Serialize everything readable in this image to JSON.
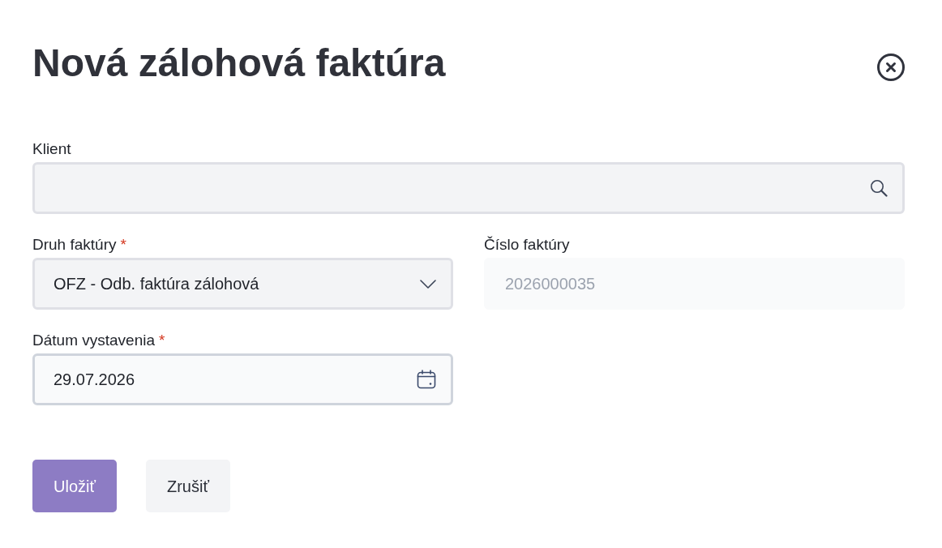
{
  "dialog": {
    "title": "Nová zálohová faktúra"
  },
  "form": {
    "rows": [
      [
        {
          "kind": "search",
          "label": "Klient",
          "disabled": false
        }
      ],
      [
        {
          "kind": "select",
          "label": "Druh faktúry",
          "required_mark": "*",
          "value": "OFZ - Odb. faktúra zálohová",
          "disabled": false
        },
        {
          "kind": "text",
          "label": "Číslo faktúry",
          "value": "2026000035",
          "disabled": true
        }
      ],
      [
        {
          "kind": "date",
          "label": "Dátum vystavenia",
          "required_mark": "*",
          "value": "29.07.2026",
          "disabled": false
        }
      ]
    ]
  },
  "buttons": [
    {
      "label": "Uložiť",
      "kind": "primary"
    },
    {
      "label": "Zrušiť",
      "kind": "secondary"
    }
  ]
}
